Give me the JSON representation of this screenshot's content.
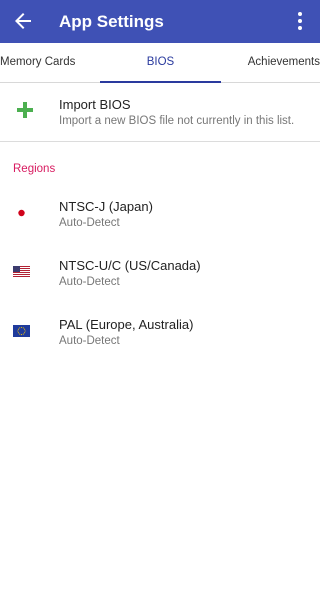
{
  "appbar": {
    "title": "App Settings",
    "back_icon": "arrow-back-icon",
    "menu_icon": "more-vert-icon",
    "background": "#3f51b5"
  },
  "tabs": [
    {
      "label": "Memory Cards",
      "selected": false
    },
    {
      "label": "BIOS",
      "selected": true
    },
    {
      "label": "Achievements",
      "selected": false
    }
  ],
  "import": {
    "title": "Import BIOS",
    "subtitle": "Import a new BIOS file not currently in this list.",
    "icon": "plus-icon",
    "icon_color": "#4caf50"
  },
  "regions_header": "Regions",
  "regions": [
    {
      "title": "NTSC-J (Japan)",
      "subtitle": "Auto-Detect",
      "icon": "japan-flag-icon"
    },
    {
      "title": "NTSC-U/C (US/Canada)",
      "subtitle": "Auto-Detect",
      "icon": "us-flag-icon"
    },
    {
      "title": "PAL (Europe, Australia)",
      "subtitle": "Auto-Detect",
      "icon": "eu-flag-icon"
    }
  ],
  "colors": {
    "accent": "#2a3a9e",
    "section_header": "#d81b60"
  }
}
